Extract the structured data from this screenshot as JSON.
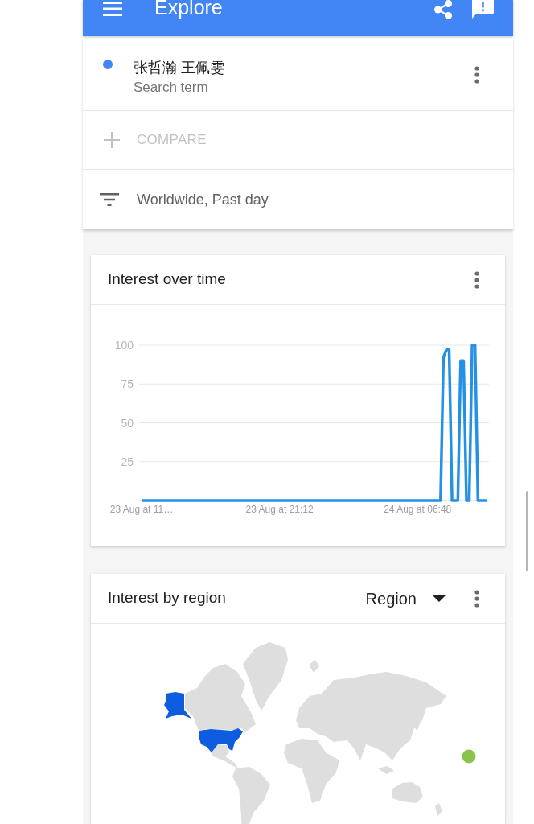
{
  "app_bar": {
    "title": "Explore"
  },
  "search_terms": [
    {
      "term": "张哲瀚 王佩雯",
      "caption": "Search term",
      "color": "#4285f4"
    }
  ],
  "compare": {
    "label": "COMPARE",
    "disabled": true
  },
  "filter": {
    "label": "Worldwide, Past day"
  },
  "cards": [
    {
      "kind": "chart",
      "title": "Interest over time",
      "chart_data": {
        "type": "line",
        "grid": true,
        "categories": [
          "23 Aug at 11…",
          null,
          null,
          null,
          null,
          null,
          null,
          null,
          null,
          null,
          null,
          null,
          null,
          null,
          null,
          null,
          null,
          null,
          null,
          null,
          null,
          null,
          null,
          null,
          null,
          null,
          null,
          null,
          null,
          null,
          null,
          null,
          null,
          null,
          null,
          null,
          null,
          null,
          null,
          null,
          null,
          null,
          null,
          null,
          null,
          null,
          null,
          null,
          "23 Aug at 21:12",
          null,
          null,
          null,
          null,
          null,
          null,
          null,
          null,
          null,
          null,
          null,
          null,
          null,
          null,
          null,
          null,
          null,
          null,
          null,
          null,
          null,
          null,
          null,
          null,
          null,
          null,
          null,
          null,
          null,
          null,
          null,
          null,
          null,
          null,
          null,
          null,
          null,
          null,
          null,
          null,
          null,
          null,
          null,
          null,
          null,
          null,
          null,
          "24 Aug at 06:48",
          null,
          null,
          null,
          null,
          null,
          null,
          null,
          null,
          null,
          null,
          null,
          null,
          null,
          null,
          null,
          null,
          null,
          null,
          null,
          null,
          null,
          null,
          null,
          null
        ],
        "series": [
          {
            "color": "#2591e6",
            "values": [
              0,
              0,
              0,
              0,
              0,
              0,
              0,
              0,
              0,
              0,
              0,
              0,
              0,
              0,
              0,
              0,
              0,
              0,
              0,
              0,
              0,
              0,
              0,
              0,
              0,
              0,
              0,
              0,
              0,
              0,
              0,
              0,
              0,
              0,
              0,
              0,
              0,
              0,
              0,
              0,
              0,
              0,
              0,
              0,
              0,
              0,
              0,
              0,
              0,
              0,
              0,
              0,
              0,
              0,
              0,
              0,
              0,
              0,
              0,
              0,
              0,
              0,
              0,
              0,
              0,
              0,
              0,
              0,
              0,
              0,
              0,
              0,
              0,
              0,
              0,
              0,
              0,
              0,
              0,
              0,
              0,
              0,
              0,
              0,
              0,
              0,
              0,
              0,
              0,
              0,
              0,
              0,
              0,
              0,
              0,
              0,
              0,
              0,
              0,
              0,
              0,
              0,
              0,
              0,
              0,
              92,
              97,
              97,
              0,
              0,
              0,
              90,
              90,
              0,
              0,
              100,
              100,
              0,
              0,
              0,
              0
            ]
          }
        ],
        "ylim": [
          0,
          100
        ],
        "yticks": [
          25,
          50,
          75,
          100
        ]
      }
    },
    {
      "kind": "map",
      "title": "Interest by region",
      "dropdown": {
        "value": "Region"
      }
    }
  ]
}
